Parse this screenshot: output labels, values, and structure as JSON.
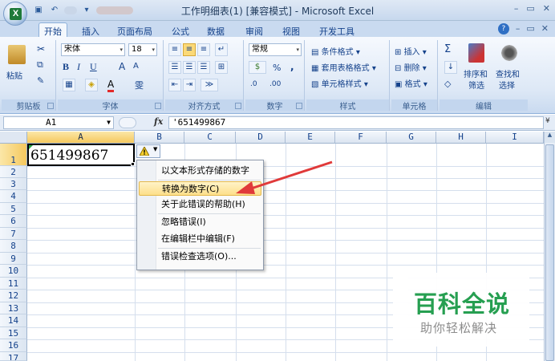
{
  "window": {
    "title": "工作明细表(1) [兼容模式] - Microsoft Excel",
    "office_logo": "X",
    "controls": [
      "–",
      "▭",
      "✕"
    ]
  },
  "ribbon": {
    "tabs": [
      "开始",
      "插入",
      "页面布局",
      "公式",
      "数据",
      "审阅",
      "视图",
      "开发工具"
    ],
    "help_icons": [
      "?",
      "–",
      "▭",
      "✕"
    ],
    "groups": {
      "clipboard": {
        "label": "剪贴板",
        "paste": "粘贴"
      },
      "font": {
        "label": "字体",
        "font_name": "宋体",
        "font_size": "18",
        "bold": "B",
        "italic": "I",
        "underline": "U",
        "grow": "A",
        "shrink": "A",
        "wen": "雯"
      },
      "alignment": {
        "label": "对齐方式"
      },
      "number": {
        "label": "数字",
        "format": "常规",
        "percent": "%",
        "comma": ",",
        "inc": ".0",
        "dec": ".00"
      },
      "styles": {
        "label": "样式",
        "cond_format": "条件格式",
        "table_format": "套用表格格式",
        "cell_styles": "单元格样式"
      },
      "cells": {
        "label": "单元格",
        "insert": "插入",
        "delete": "删除",
        "format": "格式"
      },
      "editing": {
        "label": "编辑",
        "sum": "Σ",
        "sort_filter": "排序和筛选",
        "find_select": "查找和选择",
        "sort_short": "排序和",
        "filter_short": "筛选",
        "find_short": "查找和",
        "select_short": "选择"
      }
    }
  },
  "formula_bar": {
    "name_box": "A1",
    "fx": "fx",
    "content": "'651499867"
  },
  "sheet": {
    "columns": [
      "A",
      "B",
      "C",
      "D",
      "E",
      "F",
      "G",
      "H",
      "I"
    ],
    "rows": [
      "1",
      "2",
      "3",
      "4",
      "5",
      "6",
      "7",
      "8",
      "9",
      "10",
      "11",
      "12",
      "13",
      "14",
      "15",
      "16",
      "17"
    ],
    "active_cell": "A1",
    "a1_value": "651499867"
  },
  "error_menu": {
    "items": [
      "以文本形式存储的数字",
      "转换为数字(C)",
      "关于此错误的帮助(H)",
      "忽略错误(I)",
      "在编辑栏中编辑(F)",
      "错误检查选项(O)..."
    ],
    "highlighted": "转换为数字(C)"
  },
  "watermark": {
    "line1": "百科全说",
    "line2": "助你轻松解决"
  },
  "colors": {
    "accent_arrow": "#e03a3a",
    "error_triangle": "#27a345",
    "watermark_green": "#1e9c4a"
  }
}
